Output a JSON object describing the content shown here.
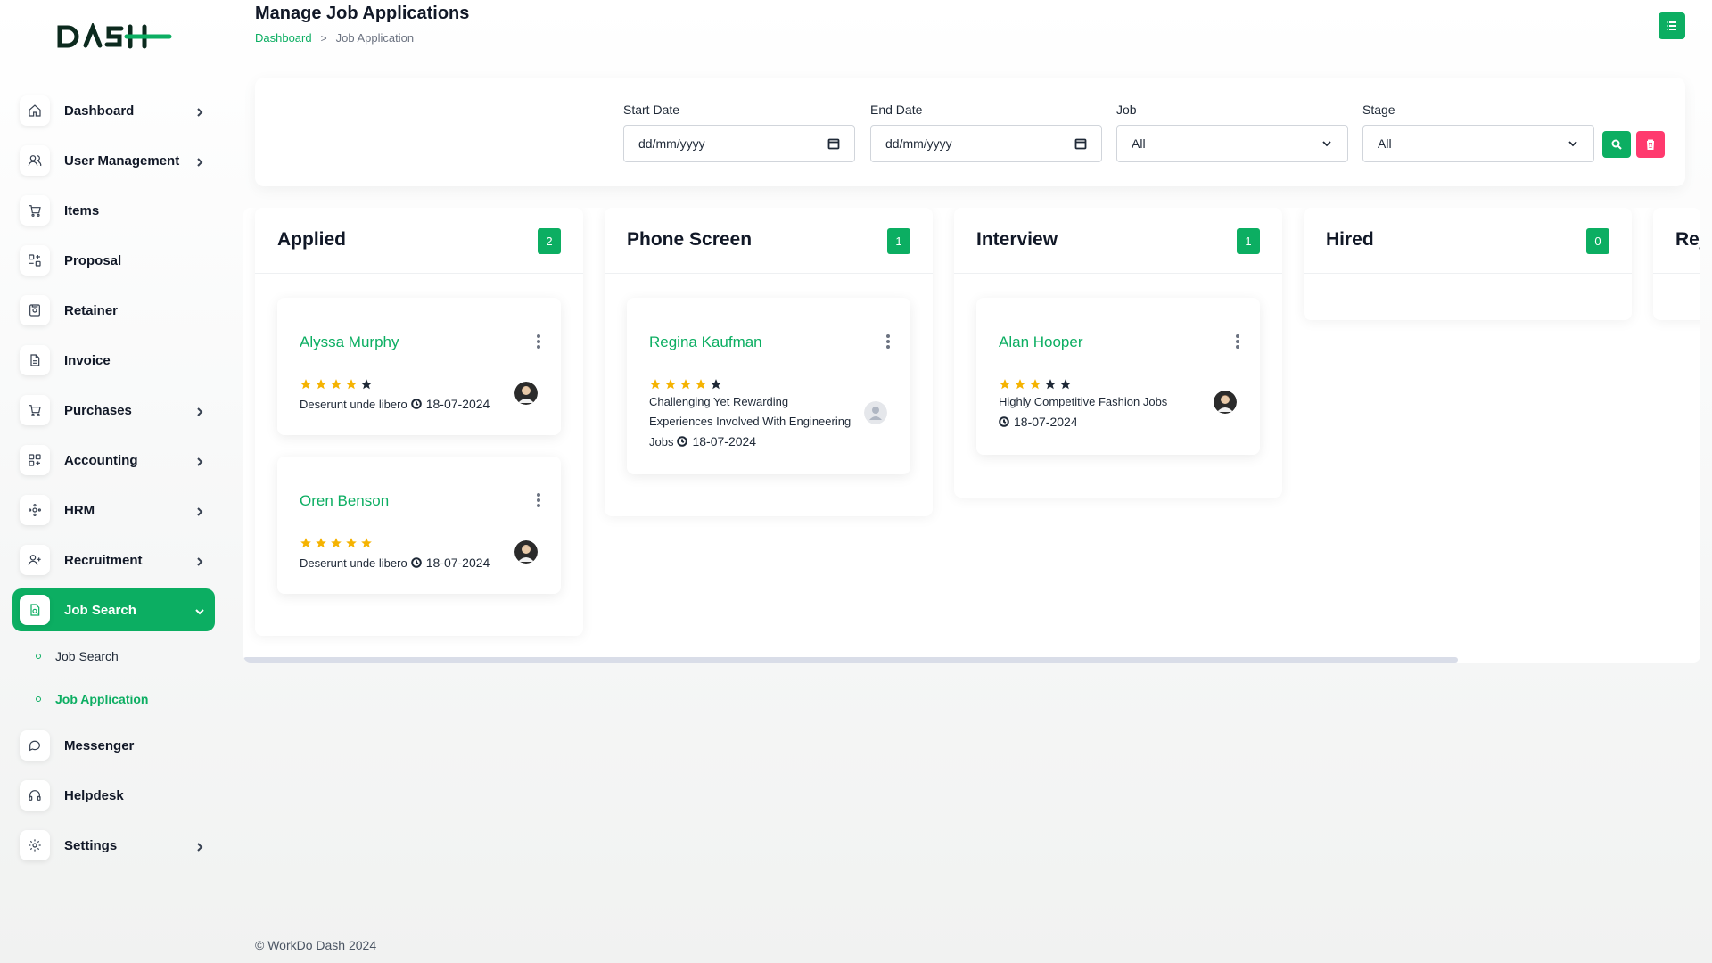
{
  "header": {
    "title": "Manage Job Applications",
    "breadcrumb": {
      "home": "Dashboard",
      "separator": ">",
      "current": "Job Application"
    }
  },
  "sidebar": {
    "logo_text": "DASH",
    "items": [
      {
        "label": "Dashboard",
        "icon": "home-icon",
        "has_children": true
      },
      {
        "label": "User Management",
        "icon": "users-icon",
        "has_children": true
      },
      {
        "label": "Items",
        "icon": "cart-icon",
        "has_children": false
      },
      {
        "label": "Proposal",
        "icon": "proposal-icon",
        "has_children": false
      },
      {
        "label": "Retainer",
        "icon": "retainer-icon",
        "has_children": false
      },
      {
        "label": "Invoice",
        "icon": "invoice-icon",
        "has_children": false
      },
      {
        "label": "Purchases",
        "icon": "cart-icon",
        "has_children": true
      },
      {
        "label": "Accounting",
        "icon": "grid-icon",
        "has_children": true
      },
      {
        "label": "HRM",
        "icon": "hrm-icon",
        "has_children": true
      },
      {
        "label": "Recruitment",
        "icon": "user-plus-icon",
        "has_children": true
      },
      {
        "label": "Job Search",
        "icon": "file-search-icon",
        "has_children": true,
        "active": true
      },
      {
        "label": "Messenger",
        "icon": "chat-icon",
        "has_children": false
      },
      {
        "label": "Helpdesk",
        "icon": "headphones-icon",
        "has_children": false
      },
      {
        "label": "Settings",
        "icon": "gear-icon",
        "has_children": true
      }
    ],
    "sub_items": [
      {
        "label": "Job Search",
        "active": false
      },
      {
        "label": "Job Application",
        "active": true
      }
    ]
  },
  "filters": {
    "start_date": {
      "label": "Start Date",
      "placeholder": "dd/mm/yyyy"
    },
    "end_date": {
      "label": "End Date",
      "placeholder": "dd/mm/yyyy"
    },
    "job": {
      "label": "Job",
      "value": "All"
    },
    "stage": {
      "label": "Stage",
      "value": "All"
    }
  },
  "kanban": {
    "columns": [
      {
        "title": "Applied",
        "count": "2",
        "cards": [
          {
            "name": "Alyssa Murphy",
            "rating": 4,
            "job": "Deserunt unde libero",
            "date": "18-07-2024"
          },
          {
            "name": "Oren Benson",
            "rating": 5,
            "job": "Deserunt unde libero",
            "date": "18-07-2024"
          }
        ]
      },
      {
        "title": "Phone Screen",
        "count": "1",
        "cards": [
          {
            "name": "Regina Kaufman",
            "rating": 4,
            "job_lines": [
              "Challenging Yet Rewarding",
              "Experiences Involved With Engineering",
              "Jobs"
            ],
            "date": "18-07-2024"
          }
        ]
      },
      {
        "title": "Interview",
        "count": "1",
        "cards": [
          {
            "name": "Alan Hooper",
            "rating": 3,
            "job": "Highly Competitive Fashion Jobs",
            "date": "18-07-2024"
          }
        ]
      },
      {
        "title": "Hired",
        "count": "0",
        "cards": []
      },
      {
        "title": "Rej",
        "count": "",
        "cards": []
      }
    ]
  },
  "footer": {
    "text": "© WorkDo Dash 2024"
  },
  "colors": {
    "accent": "#0cae62",
    "danger": "#ff3a6e",
    "star": "#f5b301"
  }
}
